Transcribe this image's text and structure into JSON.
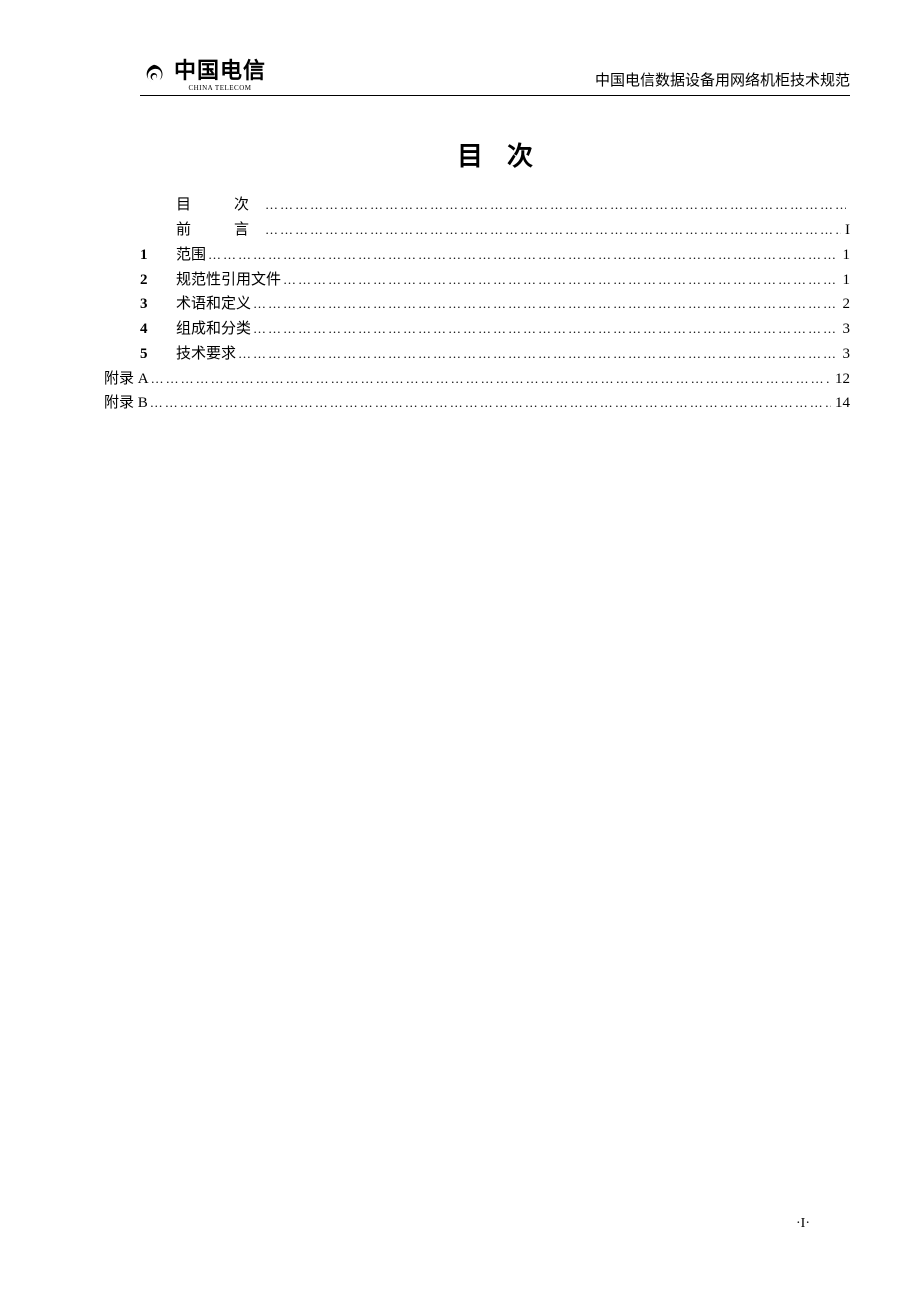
{
  "header": {
    "logo_text_cn": "中国电信",
    "logo_text_en": "CHINA TELECOM",
    "doc_title": "中国电信数据设备用网络机柜技术规范"
  },
  "toc_title": "目次",
  "toc": [
    {
      "num": "",
      "label": "目　次",
      "label_class": "spaced",
      "page": ""
    },
    {
      "num": "",
      "label": "前　言",
      "label_class": "spaced",
      "page": "I"
    },
    {
      "num": "1",
      "label": "范围",
      "label_class": "",
      "page": "1"
    },
    {
      "num": "2",
      "label": "规范性引用文件",
      "label_class": "",
      "page": "1"
    },
    {
      "num": "3",
      "label": "术语和定义",
      "label_class": "",
      "page": "2"
    },
    {
      "num": "4",
      "label": "组成和分类",
      "label_class": "",
      "page": "3"
    },
    {
      "num": "5",
      "label": "技术要求",
      "label_class": "",
      "page": "3"
    },
    {
      "num": "",
      "label": "附录 A",
      "label_class": "",
      "page": "12"
    },
    {
      "num": "",
      "label": "附录 B",
      "label_class": "",
      "page": "14"
    }
  ],
  "footer_page": "·I·"
}
